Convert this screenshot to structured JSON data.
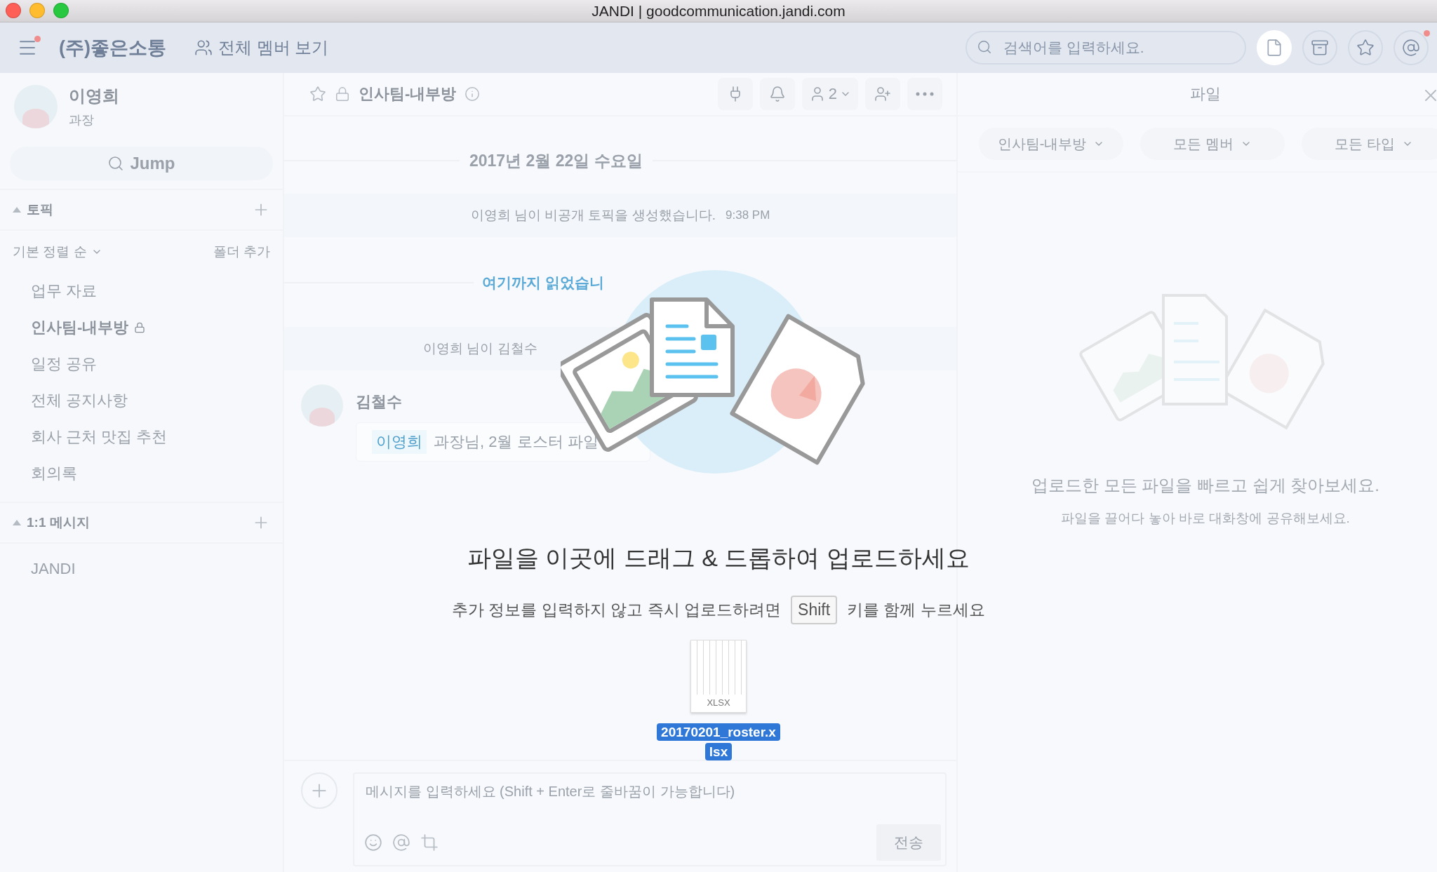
{
  "window": {
    "title": "JANDI | goodcommunication.jandi.com"
  },
  "topbar": {
    "menu_badge": true,
    "team": "(주)좋은소통",
    "members_link": "전체 멤버 보기",
    "search": {
      "placeholder": "검색어를 입력하세요."
    },
    "buttons": [
      {
        "kind": "file",
        "selected": true,
        "badge": false
      },
      {
        "kind": "archive",
        "selected": false,
        "badge": false
      },
      {
        "kind": "star",
        "selected": false,
        "badge": false
      },
      {
        "kind": "mention",
        "selected": false,
        "badge": true
      }
    ]
  },
  "profile": {
    "name": "이영희",
    "title": "과장"
  },
  "jump": "Jump",
  "sidebar": {
    "topics_header": {
      "label": "토픽",
      "expanded": true
    },
    "sort": "기본 정렬 순",
    "add_folder": "폴더 추가",
    "topics": [
      {
        "label": "업무 자료",
        "selected": false,
        "locked": false
      },
      {
        "label": "인사팀-내부방",
        "selected": true,
        "locked": true
      },
      {
        "label": "일정 공유",
        "selected": false,
        "locked": false
      },
      {
        "label": "전체 공지사항",
        "selected": false,
        "locked": false
      },
      {
        "label": "회사 근처 맛집 추천",
        "selected": false,
        "locked": false
      },
      {
        "label": "회의록",
        "selected": false,
        "locked": false
      }
    ],
    "dm_header": {
      "label": "1:1 메시지",
      "expanded": true
    },
    "dms": [
      {
        "label": "JANDI",
        "selected": false
      }
    ]
  },
  "chat": {
    "header": {
      "title": "인사팀-내부방",
      "starred": false,
      "locked": true,
      "member_count": "2"
    },
    "date": "2017년 2월 22일 수요일",
    "events": [
      {
        "kind": "system",
        "text": "이영희 님이 비공개 토픽을 생성했습니다.",
        "time": "9:38 PM"
      },
      {
        "kind": "marker",
        "text": "여기까지 읽었습니"
      },
      {
        "kind": "system",
        "text": "이영희 님이 김철수"
      },
      {
        "kind": "message",
        "author": "김철수",
        "mention": "이영희",
        "text": "과장님, 2월 로스터 파일"
      }
    ],
    "composer": {
      "placeholder": "메시지를 입력하세요 (Shift + Enter로 줄바꿈이 가능합니다)",
      "send": "전송"
    }
  },
  "files_panel": {
    "title": "파일",
    "filters": [
      "인사팀-내부방",
      "모든 멤버",
      "모든 타입"
    ],
    "empty_title": "업로드한 모든 파일을 빠르고 쉽게 찾아보세요.",
    "empty_hint": "파일을 끌어다 놓아 바로 대화창에 공유해보세요."
  },
  "drop_overlay": {
    "title": "파일을 이곳에 드래그 & 드롭하여 업로드하세요",
    "hint_before": "추가 정보를 입력하지 않고 즉시 업로드하려면",
    "key": "Shift",
    "hint_after": "키를 함께 누르세요",
    "dragged_file": {
      "type": "XLSX",
      "name_lines": [
        "20170201_roster.x",
        "lsx"
      ]
    }
  }
}
